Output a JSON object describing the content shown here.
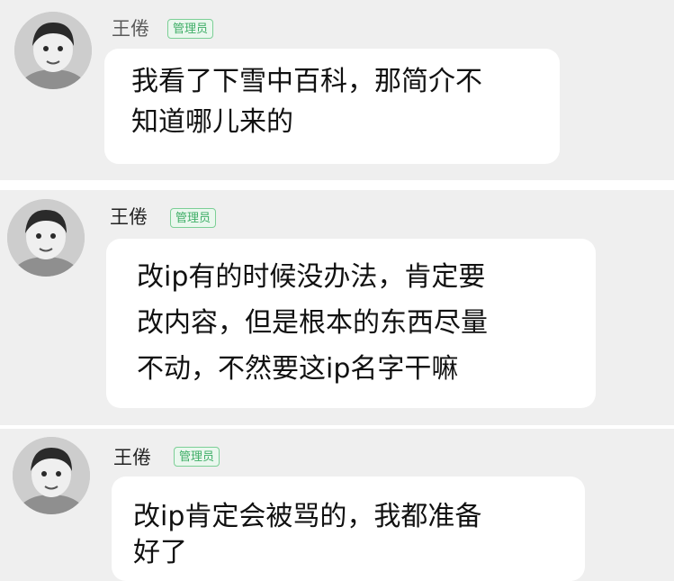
{
  "messages": [
    {
      "sender": "王倦",
      "badge": "管理员",
      "lines": [
        "我看了下雪中百科，那简介不",
        "知道哪儿来的"
      ]
    },
    {
      "sender": "王倦",
      "badge": "管理员",
      "lines": [
        "改ip有的时候没办法，肯定要",
        "改内容，但是根本的东西尽量",
        "不动，不然要这ip名字干嘛"
      ]
    },
    {
      "sender": "王倦",
      "badge": "管理员",
      "lines": [
        "改ip肯定会被骂的，我都准备",
        "好了"
      ]
    }
  ],
  "colors": {
    "panel_bg": "#efefef",
    "bubble_bg": "#ffffff",
    "badge_green": "#3fae67",
    "name_gray": "#5a5a5a"
  },
  "icons": {
    "avatar": "child-portrait-avatar"
  }
}
